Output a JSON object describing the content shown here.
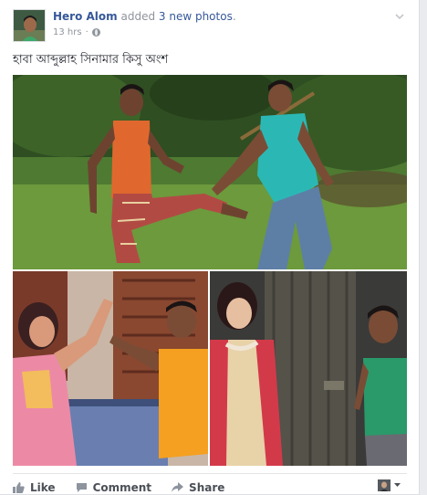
{
  "post": {
    "author": "Hero Alom",
    "activity_prefix": " added ",
    "photo_count": "3 new photos",
    "activity_suffix": ".",
    "timestamp": "13 hrs",
    "separator": "·",
    "privacy_icon": "globe-icon",
    "caption": "হাবা আব্দুল্লাহ সিনামার কিসু অংশ"
  },
  "actions": {
    "like": "Like",
    "comment": "Comment",
    "share": "Share"
  },
  "icons": {
    "options": "chevron-down-icon",
    "like": "thumbs-up-icon",
    "comment": "speech-bubble-icon",
    "share": "share-arrow-icon"
  },
  "colors": {
    "link": "#365899",
    "meta_text": "#90949c",
    "body_text": "#1d2129",
    "action_text": "#4b4f56"
  }
}
